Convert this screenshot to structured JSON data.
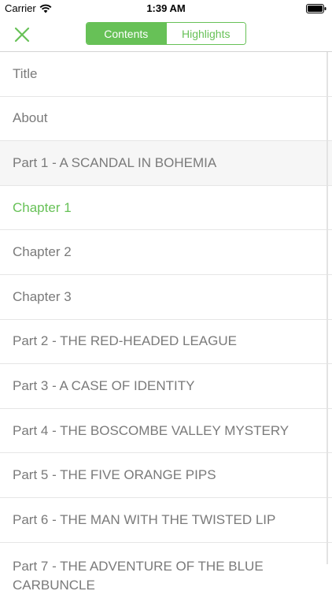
{
  "status_bar": {
    "carrier": "Carrier",
    "time": "1:39 AM",
    "wifi_icon": "wifi-icon",
    "battery_icon": "battery-icon"
  },
  "nav": {
    "close_icon": "close-icon",
    "segments": [
      "Contents",
      "Highlights"
    ],
    "selected_segment": "Contents",
    "accent_color": "#67c157"
  },
  "toc": {
    "current_item": "Chapter 1",
    "items": [
      "Title",
      "About",
      "Part 1 - A SCANDAL IN BOHEMIA",
      "Chapter 1",
      "Chapter 2",
      "Chapter 3",
      "Part 2 - THE RED-HEADED LEAGUE",
      "Part 3 - A CASE OF IDENTITY",
      "Part 4 - THE BOSCOMBE VALLEY MYSTERY",
      "Part 5 - THE FIVE ORANGE PIPS",
      "Part 6 - THE MAN WITH THE TWISTED LIP",
      "Part 7 - THE ADVENTURE OF THE BLUE CARBUNCLE"
    ]
  }
}
